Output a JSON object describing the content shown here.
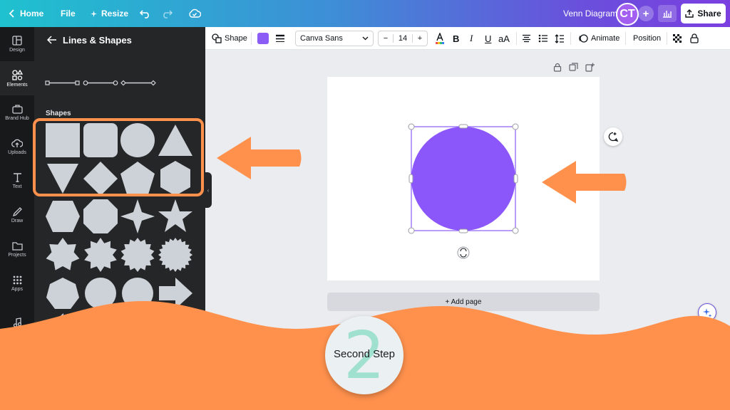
{
  "topbar": {
    "home_label": "Home",
    "file_label": "File",
    "resize_label": "Resize",
    "doc_title": "Venn Diagram",
    "avatar_initials": "CT",
    "share_label": "Share"
  },
  "rail": {
    "items": [
      {
        "label": "Design",
        "icon": "layout-icon"
      },
      {
        "label": "Elements",
        "icon": "shapes-icon"
      },
      {
        "label": "Brand Hub",
        "icon": "briefcase-icon"
      },
      {
        "label": "Uploads",
        "icon": "cloud-upload-icon"
      },
      {
        "label": "Text",
        "icon": "text-icon"
      },
      {
        "label": "Draw",
        "icon": "pen-icon"
      },
      {
        "label": "Projects",
        "icon": "folder-icon"
      },
      {
        "label": "Apps",
        "icon": "grid-icon"
      },
      {
        "label": "Audio",
        "icon": "music-note-icon"
      }
    ]
  },
  "panel": {
    "title": "Lines & Shapes",
    "shapes_label": "Shapes"
  },
  "toolbar": {
    "shape_label": "Shape",
    "fill_color": "#8b5cf6",
    "font_name": "Canva Sans",
    "font_size": "14",
    "size_minus": "−",
    "size_plus": "+",
    "bold_glyph": "B",
    "italic_glyph": "I",
    "underline_glyph": "U",
    "case_glyph": "aA",
    "animate_label": "Animate",
    "position_label": "Position"
  },
  "canvas": {
    "circle_color": "#8b57fb",
    "add_page_label": "+ Add page"
  },
  "overlay": {
    "accent_color": "#ff914d",
    "step_number": "2",
    "step_text": "Second Step"
  }
}
